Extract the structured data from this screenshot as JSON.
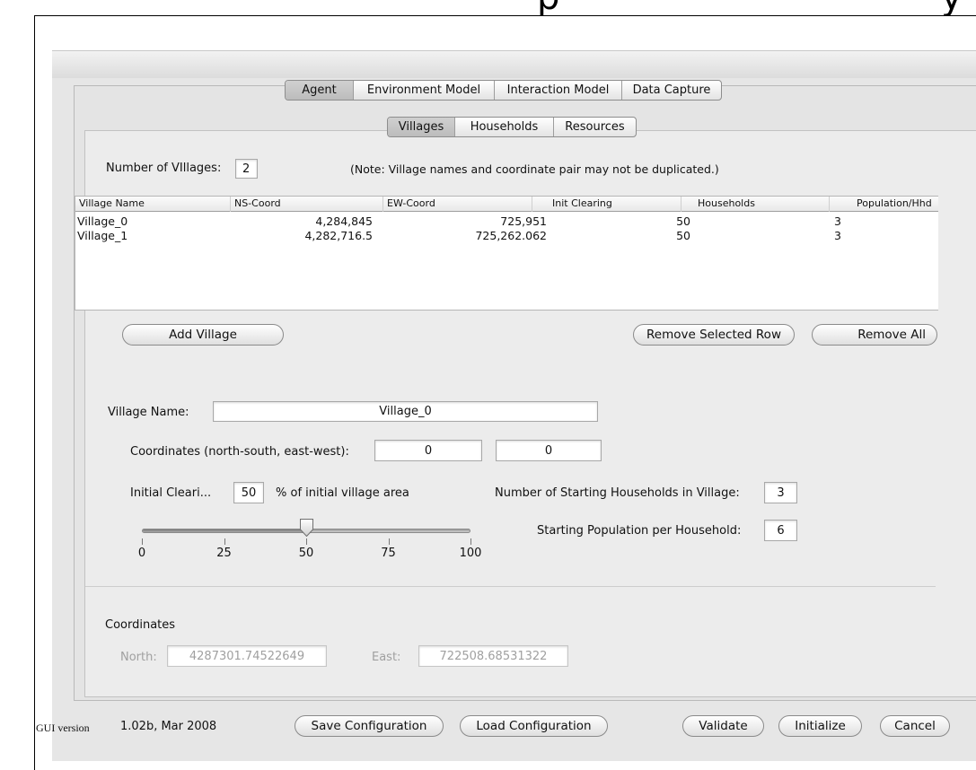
{
  "agent_tabs": [
    "Agent",
    "Environment Model",
    "Interaction Model",
    "Data Capture"
  ],
  "agent_tab_active": "Agent",
  "sub_tabs": [
    "Villages",
    "Households",
    "Resources"
  ],
  "sub_tab_active": "Villages",
  "num_villages": {
    "label": "Number of VIllages:",
    "value": "2"
  },
  "note": "(Note: Village names and coordinate pair may not be duplicated.)",
  "table": {
    "columns": [
      "Village Name",
      "NS-Coord",
      "EW-Coord",
      "Init Clearing",
      "Households",
      "Population/Hhd"
    ],
    "rows": [
      [
        "Village_0",
        "4,284,845",
        "725,951",
        "50",
        "3"
      ],
      [
        "Village_1",
        "4,282,716.5",
        "725,262.062",
        "50",
        "3"
      ]
    ]
  },
  "buttons": {
    "add_village": "Add Village",
    "remove_selected": "Remove Selected Row",
    "remove_all": "Remove All",
    "save": "Save Configuration",
    "load": "Load Configuration",
    "validate": "Validate",
    "initialize": "Initialize",
    "cancel": "Cancel"
  },
  "village_name": {
    "label": "Village Name:",
    "value": "Village_0"
  },
  "coordinates_entry": {
    "label": "Coordinates (north-south, east-west):",
    "ns": "0",
    "ew": "0"
  },
  "initial_clearing": {
    "label": "Initial Cleari...",
    "value": "50",
    "suffix": "% of initial village area"
  },
  "slider": {
    "value": 50,
    "min": 0,
    "max": 100,
    "tick_labels": [
      "0",
      "25",
      "50",
      "75",
      "100"
    ]
  },
  "households": {
    "label": "Number of Starting Households in Village:",
    "value": "3"
  },
  "population": {
    "label": "Starting Population per Household:",
    "value": "6"
  },
  "coordinates_display": {
    "heading": "Coordinates",
    "north_label": "North:",
    "north_value": "4287301.74522649",
    "east_label": "East:",
    "east_value": "722508.68531322"
  },
  "gui_version": {
    "prefix": "GUI version",
    "value": "1.02b, Mar 2008"
  },
  "window_controls": [
    "close-light",
    "minimize-light",
    "zoom-light"
  ],
  "colors": {
    "window_bg": "#e6e6e6",
    "panel_bg": "#ececec",
    "field_bg": "#ffffff",
    "disabled_text": "#a0a0a0"
  }
}
